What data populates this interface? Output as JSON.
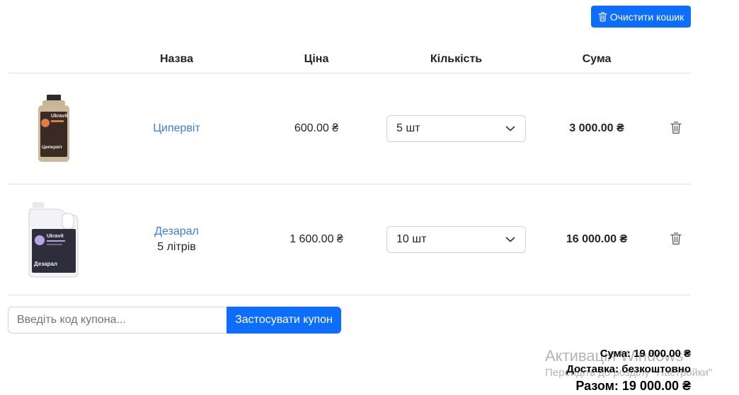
{
  "toolbar": {
    "clear_cart_label": "Очистити кошик"
  },
  "table": {
    "headers": {
      "name": "Назва",
      "price": "Ціна",
      "quantity": "Кількість",
      "sum": "Сума"
    },
    "items": [
      {
        "name": "Ципервіт",
        "subtitle": "",
        "price": "600.00 ₴",
        "quantity": "5 шт",
        "sum": "3 000.00 ₴",
        "brand": "Ukravit",
        "label": "Ципервіт"
      },
      {
        "name": "Дезарал",
        "subtitle": "5 літрів",
        "price": "1 600.00 ₴",
        "quantity": "10 шт",
        "sum": "16 000.00 ₴",
        "brand": "Ukravit",
        "label": "Дезарал"
      }
    ]
  },
  "coupon": {
    "placeholder": "Введіть код купона...",
    "value": "",
    "apply_label": "Застосувати купон"
  },
  "totals": {
    "subtotal": "Сума: 19 000.00 ₴",
    "delivery": "Доставка: безкоштовно",
    "total": "Разом: 19 000.00 ₴"
  },
  "watermark": {
    "title": "Активація Windows",
    "subtitle": "Перейдіть до розділу \"Настройки\""
  },
  "colors": {
    "primary": "#0d6efd",
    "link": "#3b7ddd",
    "border": "#dee2e6"
  }
}
